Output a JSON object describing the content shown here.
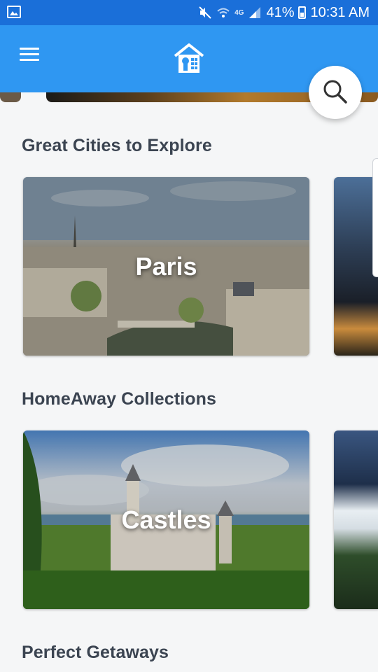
{
  "status_bar": {
    "battery": "41%",
    "time": "10:31 AM",
    "network": "4G"
  },
  "app_bar": {
    "menu_icon": "hamburger-menu-icon",
    "logo_icon": "homeaway-logo-icon"
  },
  "search_fab": {
    "icon": "search-icon"
  },
  "sections": [
    {
      "title": "Great Cities to Explore",
      "cards": [
        {
          "label": "Paris"
        }
      ]
    },
    {
      "title": "HomeAway Collections",
      "cards": [
        {
          "label": "Castles"
        }
      ]
    },
    {
      "title": "Perfect Getaways"
    }
  ],
  "colors": {
    "status_bar": "#1a6fd9",
    "app_bar": "#2f97f2",
    "background": "#f5f6f7",
    "section_title": "#3b4451"
  }
}
